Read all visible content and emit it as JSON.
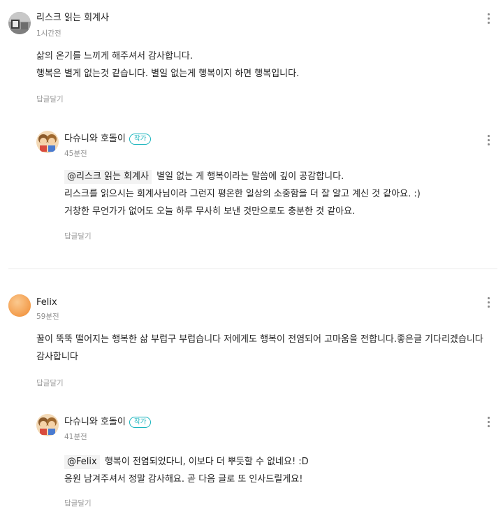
{
  "comments": [
    {
      "author": "리스크 읽는 회계사",
      "time": "1시간전",
      "lines": [
        "삶의 온기를 느끼게 해주셔서 감사합니다.",
        "행복은 별게 없는것 같습니다. 별일 없는게 행복이지 하면 행복입니다."
      ],
      "reply_label": "답글달기",
      "more_icon": "more-vertical-icon",
      "reply": {
        "author": "다슈니와 호돌이",
        "badge": "작가",
        "time": "45분전",
        "mention": "@리스크 읽는 회계사",
        "line1": "별일 없는 게 행복이라는 말씀에 깊이 공감합니다.",
        "line2": "리스크를 읽으시는 회계사님이라 그런지 평온한 일상의 소중함을 더 잘 알고 계신 것 같아요. :)",
        "line3": "거창한 무언가가 없어도 오늘 하루 무사히 보낸 것만으로도 충분한 것 같아요.",
        "reply_label": "답글달기"
      }
    },
    {
      "author": "Felix",
      "time": "59분전",
      "text": "꿀이 뚝뚝 떨어지는 행복한 삶 부럽구 부럽습니다 저에게도 행복이 전염되어 고마움을 전합니다.좋은글 기다리겠습니다 감사합니다",
      "reply_label": "답글달기",
      "reply": {
        "author": "다슈니와 호돌이",
        "badge": "작가",
        "time": "41분전",
        "mention": "@Felix",
        "line1": "행복이 전염되었다니, 이보다 더 뿌듯할 수 없네요! :D",
        "line2": "응원 남겨주셔서 정말 감사해요. 곧 다음 글로 또 인사드릴게요!",
        "reply_label": "답글달기"
      }
    }
  ],
  "colors": {
    "author_badge": "#18b4bd",
    "meta_text": "#909090",
    "divider": "#ececec",
    "mention_bg": "#f3f3f3",
    "felix_avatar": "#f7a55a"
  }
}
